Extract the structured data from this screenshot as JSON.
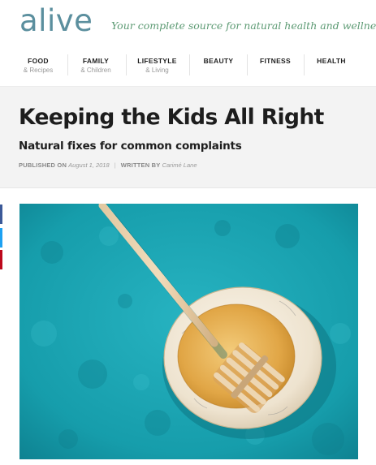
{
  "header": {
    "logo": "alive",
    "tagline": "Your complete source for natural health and wellness"
  },
  "nav": {
    "items": [
      {
        "label": "FOOD",
        "sub": "& Recipes"
      },
      {
        "label": "FAMILY",
        "sub": "& Children"
      },
      {
        "label": "LIFESTYLE",
        "sub": "& Living"
      },
      {
        "label": "BEAUTY",
        "sub": ""
      },
      {
        "label": "FITNESS",
        "sub": ""
      },
      {
        "label": "HEALTH",
        "sub": ""
      }
    ]
  },
  "article": {
    "title": "Keeping the Kids All Right",
    "subtitle": "Natural fixes for common complaints",
    "published_label": "PUBLISHED ON",
    "published_date": "August 1, 2018",
    "written_label": "WRITTEN BY",
    "author": "Carimé Lane"
  },
  "colors": {
    "logo": "#5b8f9e",
    "tagline": "#5c9a73",
    "facebook": "#3b5998",
    "twitter": "#1da1f2",
    "pinterest": "#bd081c",
    "photo_background": "#1fa8b5"
  },
  "icons": [
    "facebook-share-icon",
    "twitter-share-icon",
    "pinterest-share-icon"
  ]
}
